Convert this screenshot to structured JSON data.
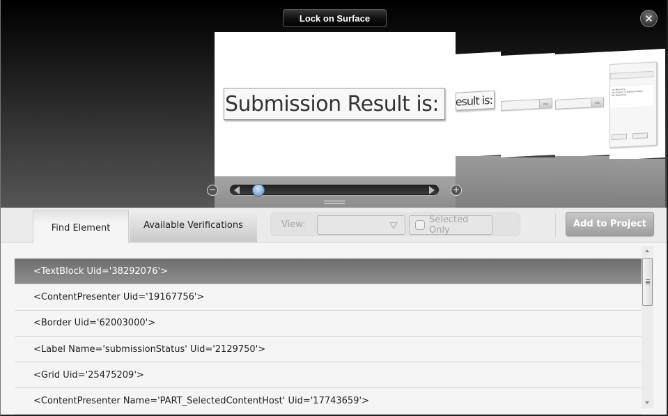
{
  "stage": {
    "lock_button": "Lock on Surface",
    "close_icon": "close-icon",
    "preview_main_text": "Submission Result is:",
    "preview_partial_text": "esult is:",
    "mini_button_text": "Cre",
    "mini_dialog_lines": [
      "ust Recovery",
      "ost Greater in Implementation",
      "Fail Reporting"
    ],
    "slider": {
      "zoom_out_icon": "minus-icon",
      "zoom_in_icon": "plus-icon",
      "position_fraction": 0.06
    }
  },
  "panel": {
    "tabs": [
      {
        "label": "Find Element",
        "active": true
      },
      {
        "label": "Available Verifications",
        "active": false
      }
    ],
    "view_label": "View:",
    "view_select_value": "",
    "selected_only_label": "Selected Only",
    "selected_only_checked": false,
    "add_button": "Add to Project",
    "elements": [
      {
        "text": "<TextBlock Uid='38292076'>",
        "selected": true
      },
      {
        "text": "<ContentPresenter Uid='19167756'>",
        "selected": false
      },
      {
        "text": "<Border Uid='62003000'>",
        "selected": false
      },
      {
        "text": "<Label Name='submissionStatus' Uid='2129750'>",
        "selected": false
      },
      {
        "text": "<Grid Uid='25475209'>",
        "selected": false
      },
      {
        "text": "<ContentPresenter Name='PART_SelectedContentHost' Uid='17743659'>",
        "selected": false
      }
    ]
  }
}
